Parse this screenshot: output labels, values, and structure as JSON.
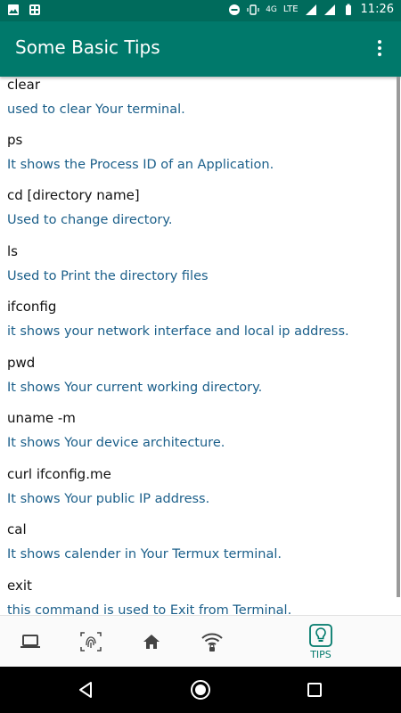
{
  "status_bar": {
    "network_4g": "4G",
    "network_lte": "LTE",
    "time": "11:26"
  },
  "app_bar": {
    "title": "Some Basic Tips",
    "menu_icon": "more-vert-icon"
  },
  "tips": [
    {
      "command": "clear",
      "description": "used to clear Your terminal."
    },
    {
      "command": "ps",
      "description": "It shows the Process ID of an Application."
    },
    {
      "command": "cd [directory name]",
      "description": "Used to change directory."
    },
    {
      "command": "ls",
      "description": "Used to Print the directory files"
    },
    {
      "command": "ifconfig",
      "description": "it shows your network interface and local ip address."
    },
    {
      "command": "pwd",
      "description": "It shows Your current working directory."
    },
    {
      "command": "uname -m",
      "description": "It shows Your device architecture."
    },
    {
      "command": "curl ifconfig.me",
      "description": "It shows Your public IP address."
    },
    {
      "command": "cal",
      "description": "It shows calender in Your Termux terminal."
    },
    {
      "command": "exit",
      "description": "this command is used to Exit from Terminal."
    }
  ],
  "bottom_nav": {
    "items": [
      {
        "icon": "laptop-icon",
        "label": ""
      },
      {
        "icon": "fingerprint-icon",
        "label": ""
      },
      {
        "icon": "home-icon",
        "label": ""
      },
      {
        "icon": "wifi-lock-icon",
        "label": ""
      },
      {
        "icon": "lightbulb-icon",
        "label": "TIPS"
      }
    ],
    "active_color": "#00796b"
  },
  "colors": {
    "primary": "#00796b",
    "status_bar": "#006b5c",
    "description_text": "#1b5f8a"
  }
}
